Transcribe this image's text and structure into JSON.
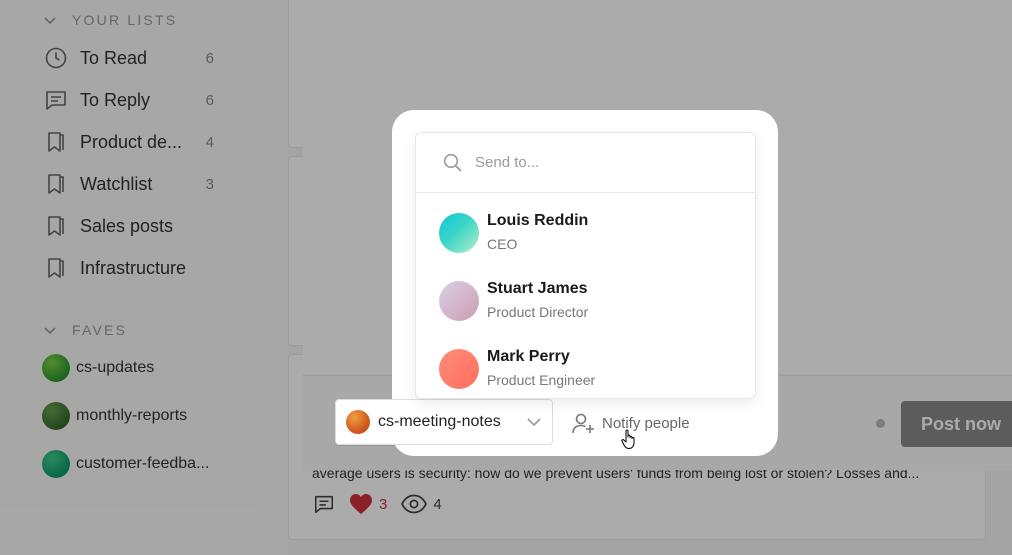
{
  "sidebar": {
    "your_lists_header": "YOUR LISTS",
    "lists": [
      {
        "label": "To Read",
        "count": "6",
        "icon": "clock-icon"
      },
      {
        "label": "To Reply",
        "count": "6",
        "icon": "message-icon"
      },
      {
        "label": "Product de...",
        "count": "4",
        "icon": "bookmark-icon"
      },
      {
        "label": "Watchlist",
        "count": "3",
        "icon": "bookmark-icon"
      },
      {
        "label": "Sales posts",
        "count": "",
        "icon": "bookmark-icon"
      },
      {
        "label": "Infrastructure",
        "count": "",
        "icon": "bookmark-icon"
      }
    ],
    "faves_header": "FAVES",
    "faves": [
      {
        "label": "cs-updates",
        "color": "#3aa83a"
      },
      {
        "label": "monthly-reports",
        "color": "#3d7a34"
      },
      {
        "label": "customer-feedba...",
        "color": "#1aa877"
      }
    ]
  },
  "feed": {
    "excerpt": "average users is security: how do we prevent users' funds from being lost or stolen? Losses and...",
    "comments_icon": "comment-icon",
    "likes": "3",
    "views": "4"
  },
  "composer": {
    "channel": "cs-meeting-notes",
    "notify_label": "Notify people",
    "post_button": "Post now"
  },
  "notify_dropdown": {
    "search_placeholder": "Send to...",
    "people": [
      {
        "name": "Louis Reddin",
        "role": "CEO"
      },
      {
        "name": "Stuart James",
        "role": "Product Director"
      },
      {
        "name": "Mark Perry",
        "role": "Product Engineer"
      }
    ]
  },
  "colors": {
    "accent_heart": "#d0303a",
    "post_button_disabled": "#8a8a8a"
  }
}
